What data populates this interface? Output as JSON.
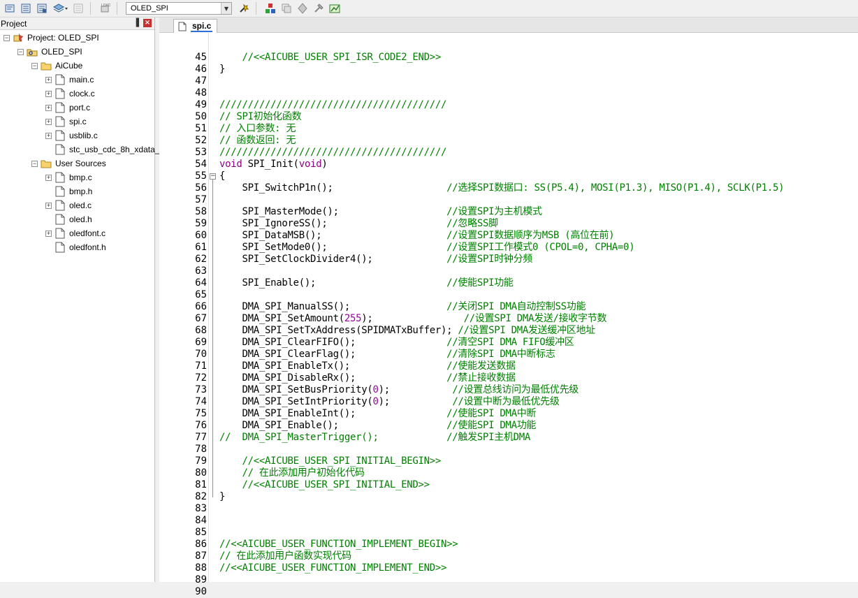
{
  "toolbar": {
    "target": "OLED_SPI",
    "icons": [
      "translate-icon",
      "build-icon",
      "rebuild-icon",
      "batch-build-icon",
      "stop-build-icon",
      "download-icon",
      "target-options-icon",
      "manage-components-icon",
      "copy-icon",
      "settings-icon",
      "env-icon"
    ]
  },
  "project": {
    "header": "Project",
    "pin": "▐",
    "close": "×",
    "items": [
      {
        "label": "Project: OLED_SPI",
        "level": 0,
        "expander": "-",
        "icon": "project"
      },
      {
        "label": "OLED_SPI",
        "level": 1,
        "expander": "-",
        "icon": "target"
      },
      {
        "label": "AiCube",
        "level": 2,
        "expander": "-",
        "icon": "folder"
      },
      {
        "label": "main.c",
        "level": 3,
        "expander": "+",
        "icon": "file"
      },
      {
        "label": "clock.c",
        "level": 3,
        "expander": "+",
        "icon": "file"
      },
      {
        "label": "port.c",
        "level": 3,
        "expander": "+",
        "icon": "file"
      },
      {
        "label": "spi.c",
        "level": 3,
        "expander": "+",
        "icon": "file"
      },
      {
        "label": "usblib.c",
        "level": 3,
        "expander": "+",
        "icon": "file"
      },
      {
        "label": "stc_usb_cdc_8h_xdata_",
        "level": 3,
        "expander": "",
        "icon": "file"
      },
      {
        "label": "User Sources",
        "level": 2,
        "expander": "-",
        "icon": "folder"
      },
      {
        "label": "bmp.c",
        "level": 3,
        "expander": "+",
        "icon": "file"
      },
      {
        "label": "bmp.h",
        "level": 3,
        "expander": "",
        "icon": "file"
      },
      {
        "label": "oled.c",
        "level": 3,
        "expander": "+",
        "icon": "file"
      },
      {
        "label": "oled.h",
        "level": 3,
        "expander": "",
        "icon": "file"
      },
      {
        "label": "oledfont.c",
        "level": 3,
        "expander": "+",
        "icon": "file"
      },
      {
        "label": "oledfont.h",
        "level": 3,
        "expander": "",
        "icon": "file"
      }
    ]
  },
  "editor": {
    "tab": "spi.c",
    "lines": [
      {
        "n": "45",
        "t": [
          [
            "cm",
            "    //<<AICUBE_USER_SPI_ISR_CODE2_END>>"
          ]
        ]
      },
      {
        "n": "46",
        "t": [
          [
            "",
            "}"
          ]
        ]
      },
      {
        "n": "47",
        "t": []
      },
      {
        "n": "48",
        "t": []
      },
      {
        "n": "49",
        "t": [
          [
            "cm",
            "////////////////////////////////////////"
          ]
        ]
      },
      {
        "n": "50",
        "t": [
          [
            "cm",
            "// SPI初始化函数"
          ]
        ]
      },
      {
        "n": "51",
        "t": [
          [
            "cm",
            "// 入口参数: 无"
          ]
        ]
      },
      {
        "n": "52",
        "t": [
          [
            "cm",
            "// 函数返回: 无"
          ]
        ]
      },
      {
        "n": "53",
        "t": [
          [
            "cm",
            "////////////////////////////////////////"
          ]
        ]
      },
      {
        "n": "54",
        "t": [
          [
            "kw",
            "void"
          ],
          [
            "",
            " SPI_Init("
          ],
          [
            "kw",
            "void"
          ],
          [
            "",
            ")"
          ]
        ]
      },
      {
        "n": "55",
        "t": [
          [
            "",
            "{"
          ]
        ]
      },
      {
        "n": "56",
        "t": [
          [
            "",
            "    SPI_SwitchP1n();                    "
          ],
          [
            "cm",
            "//选择SPI数据口: SS(P5.4), MOSI(P1.3), MISO(P1.4), SCLK(P1.5)"
          ]
        ]
      },
      {
        "n": "57",
        "t": []
      },
      {
        "n": "58",
        "t": [
          [
            "",
            "    SPI_MasterMode();                   "
          ],
          [
            "cm",
            "//设置SPI为主机模式"
          ]
        ]
      },
      {
        "n": "59",
        "t": [
          [
            "",
            "    SPI_IgnoreSS();                     "
          ],
          [
            "cm",
            "//忽略SS脚"
          ]
        ]
      },
      {
        "n": "60",
        "t": [
          [
            "",
            "    SPI_DataMSB();                      "
          ],
          [
            "cm",
            "//设置SPI数据顺序为MSB (高位在前)"
          ]
        ]
      },
      {
        "n": "61",
        "t": [
          [
            "",
            "    SPI_SetMode0();                     "
          ],
          [
            "cm",
            "//设置SPI工作模式0 (CPOL=0, CPHA=0)"
          ]
        ]
      },
      {
        "n": "62",
        "t": [
          [
            "",
            "    SPI_SetClockDivider4();             "
          ],
          [
            "cm",
            "//设置SPI时钟分频"
          ]
        ]
      },
      {
        "n": "63",
        "t": []
      },
      {
        "n": "64",
        "t": [
          [
            "",
            "    SPI_Enable();                       "
          ],
          [
            "cm",
            "//使能SPI功能"
          ]
        ]
      },
      {
        "n": "65",
        "t": []
      },
      {
        "n": "66",
        "t": [
          [
            "",
            "    DMA_SPI_ManualSS();                 "
          ],
          [
            "cm",
            "//关闭SPI DMA自动控制SS功能"
          ]
        ]
      },
      {
        "n": "67",
        "t": [
          [
            "",
            "    DMA_SPI_SetAmount("
          ],
          [
            "num",
            "255"
          ],
          [
            "",
            "); "
          ],
          [
            "",
            "               "
          ],
          [
            "cm",
            "//设置SPI DMA发送/接收字节数"
          ]
        ]
      },
      {
        "n": "68",
        "t": [
          [
            "",
            "    DMA_SPI_SetTxAddress(SPIDMATxBuffer); "
          ],
          [
            "cm",
            "//设置SPI DMA发送缓冲区地址"
          ]
        ]
      },
      {
        "n": "69",
        "t": [
          [
            "",
            "    DMA_SPI_ClearFIFO();                "
          ],
          [
            "cm",
            "//清空SPI DMA FIFO缓冲区"
          ]
        ]
      },
      {
        "n": "70",
        "t": [
          [
            "",
            "    DMA_SPI_ClearFlag();                "
          ],
          [
            "cm",
            "//清除SPI DMA中断标志"
          ]
        ]
      },
      {
        "n": "71",
        "t": [
          [
            "",
            "    DMA_SPI_EnableTx();                 "
          ],
          [
            "cm",
            "//使能发送数据"
          ]
        ]
      },
      {
        "n": "72",
        "t": [
          [
            "",
            "    DMA_SPI_DisableRx();                "
          ],
          [
            "cm",
            "//禁止接收数据"
          ]
        ]
      },
      {
        "n": "73",
        "t": [
          [
            "",
            "    DMA_SPI_SetBusPriority("
          ],
          [
            "num",
            "0"
          ],
          [
            "",
            ");           "
          ],
          [
            "cm",
            "//设置总线访问为最低优先级"
          ]
        ]
      },
      {
        "n": "74",
        "t": [
          [
            "",
            "    DMA_SPI_SetIntPriority("
          ],
          [
            "num",
            "0"
          ],
          [
            "",
            ");           "
          ],
          [
            "cm",
            "//设置中断为最低优先级"
          ]
        ]
      },
      {
        "n": "75",
        "t": [
          [
            "",
            "    DMA_SPI_EnableInt();                "
          ],
          [
            "cm",
            "//使能SPI DMA中断"
          ]
        ]
      },
      {
        "n": "76",
        "t": [
          [
            "",
            "    DMA_SPI_Enable();                   "
          ],
          [
            "cm",
            "//使能SPI DMA功能"
          ]
        ]
      },
      {
        "n": "77",
        "t": [
          [
            "cm",
            "//  DMA_SPI_MasterTrigger();            //触发SPI主机DMA"
          ]
        ]
      },
      {
        "n": "78",
        "t": []
      },
      {
        "n": "79",
        "t": [
          [
            "cm",
            "    //<<AICUBE_USER_SPI_INITIAL_BEGIN>>"
          ]
        ]
      },
      {
        "n": "80",
        "t": [
          [
            "cm",
            "    // 在此添加用户初始化代码"
          ]
        ]
      },
      {
        "n": "81",
        "t": [
          [
            "cm",
            "    //<<AICUBE_USER_SPI_INITIAL_END>>"
          ]
        ]
      },
      {
        "n": "82",
        "t": [
          [
            "",
            "}"
          ]
        ]
      },
      {
        "n": "83",
        "t": []
      },
      {
        "n": "84",
        "t": []
      },
      {
        "n": "85",
        "t": []
      },
      {
        "n": "86",
        "t": [
          [
            "cm",
            "//<<AICUBE_USER_FUNCTION_IMPLEMENT_BEGIN>>"
          ]
        ]
      },
      {
        "n": "87",
        "t": [
          [
            "cm",
            "// 在此添加用户函数实现代码"
          ]
        ]
      },
      {
        "n": "88",
        "t": [
          [
            "cm",
            "//<<AICUBE_USER_FUNCTION_IMPLEMENT_END>>"
          ]
        ]
      },
      {
        "n": "89",
        "t": []
      },
      {
        "n": "90",
        "t": []
      }
    ]
  }
}
